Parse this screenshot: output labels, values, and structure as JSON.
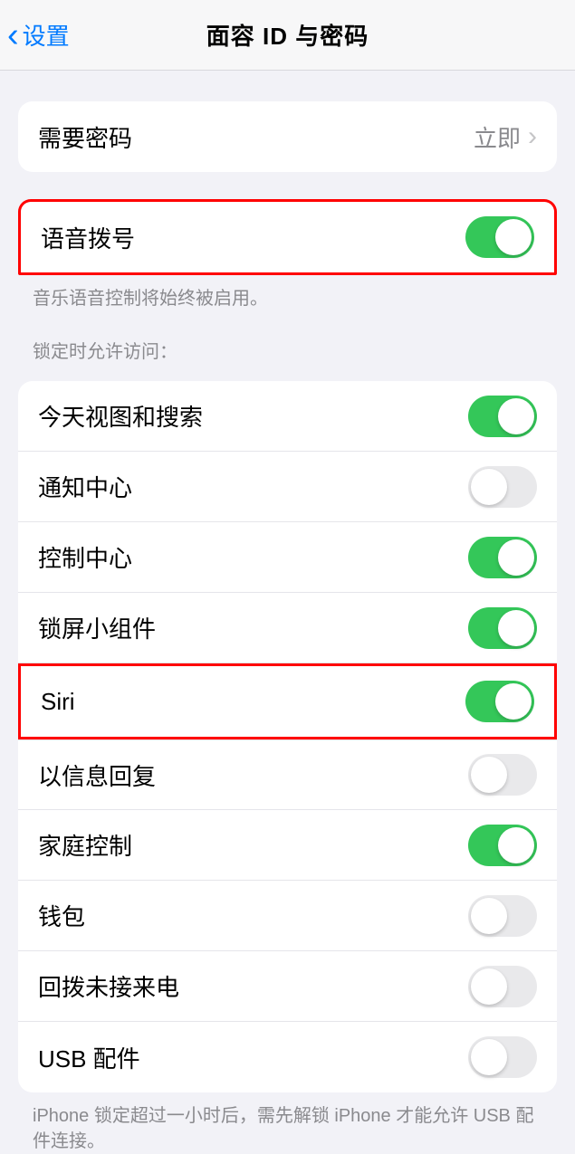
{
  "nav": {
    "back": "设置",
    "title": "面容 ID 与密码"
  },
  "passcode": {
    "label": "需要密码",
    "value": "立即"
  },
  "voice_dial": {
    "label": "语音拨号",
    "on": true,
    "footer": "音乐语音控制将始终被启用。"
  },
  "locked_access": {
    "header": "锁定时允许访问：",
    "items": [
      {
        "label": "今天视图和搜索",
        "on": true
      },
      {
        "label": "通知中心",
        "on": false
      },
      {
        "label": "控制中心",
        "on": true
      },
      {
        "label": "锁屏小组件",
        "on": true
      },
      {
        "label": "Siri",
        "on": true
      },
      {
        "label": "以信息回复",
        "on": false
      },
      {
        "label": "家庭控制",
        "on": true
      },
      {
        "label": "钱包",
        "on": false
      },
      {
        "label": "回拨未接来电",
        "on": false
      },
      {
        "label": "USB 配件",
        "on": false
      }
    ],
    "footer": "iPhone 锁定超过一小时后，需先解锁 iPhone 才能允许 USB 配件连接。"
  }
}
